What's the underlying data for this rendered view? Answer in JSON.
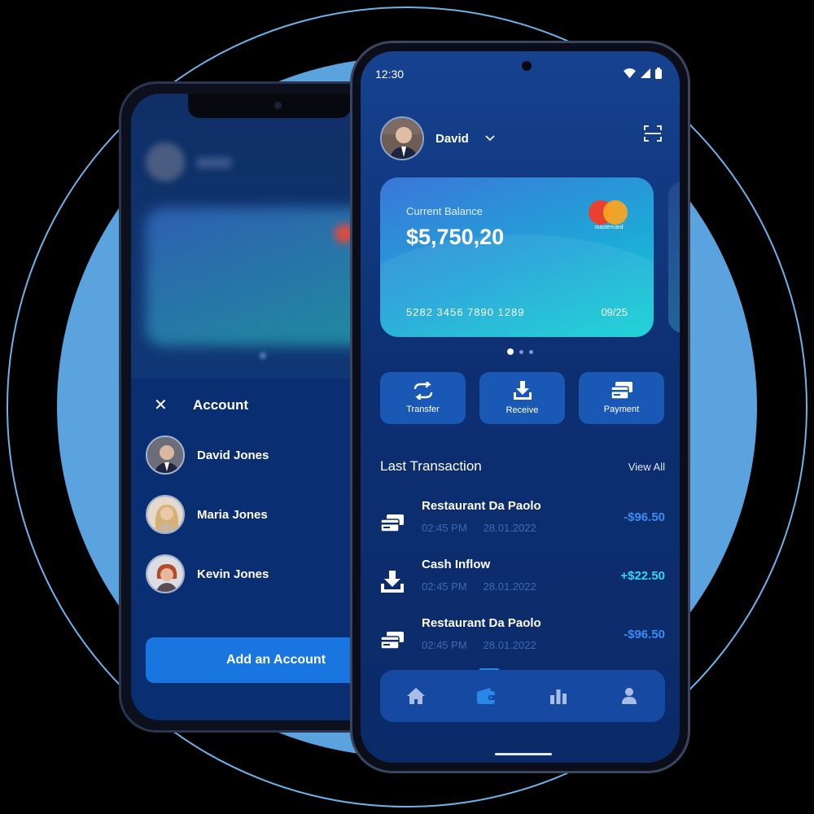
{
  "colors": {
    "background_circle": "#5aa3de",
    "screen_bg": "#0d2f72",
    "accent_blue": "#1976e0",
    "negative_amount": "#3d8cf0",
    "positive_amount": "#35d7f0",
    "card_gradient_start": "#3b76d9",
    "card_gradient_end": "#12d2d4"
  },
  "account_sheet": {
    "close_icon": "close-icon",
    "title": "Account",
    "accounts": [
      {
        "name": "David Jones"
      },
      {
        "name": "Maria Jones"
      },
      {
        "name": "Kevin Jones"
      }
    ],
    "add_button_label": "Add an Account"
  },
  "status_bar": {
    "time": "12:30",
    "icons": [
      "wifi-icon",
      "signal-icon",
      "battery-icon"
    ]
  },
  "profile": {
    "name": "David",
    "dropdown_icon": "chevron-down-icon",
    "scan_icon": "scan-icon"
  },
  "card": {
    "label": "Current Balance",
    "balance": "$5,750,20",
    "brand": "mastercard",
    "number": "5282 3456 7890 1289",
    "expiry": "09/25",
    "page_indicator": {
      "count": 3,
      "active_index": 0
    }
  },
  "actions": [
    {
      "label": "Transfer",
      "icon": "transfer-icon"
    },
    {
      "label": "Receive",
      "icon": "download-icon"
    },
    {
      "label": "Payment",
      "icon": "cards-icon"
    }
  ],
  "transactions_section": {
    "title": "Last Transaction",
    "view_all": "View All"
  },
  "transactions": [
    {
      "title": "Restaurant Da Paolo",
      "time": "02:45 PM",
      "date": "28.01.2022",
      "amount": "-$96.50",
      "icon": "cards-icon",
      "type": "debit"
    },
    {
      "title": "Cash Inflow",
      "time": "02:45 PM",
      "date": "28.01.2022",
      "amount": "+$22.50",
      "icon": "download-icon",
      "type": "credit"
    },
    {
      "title": "Restaurant Da Paolo",
      "time": "02:45 PM",
      "date": "28.01.2022",
      "amount": "-$96.50",
      "icon": "cards-icon",
      "type": "debit"
    }
  ],
  "bottom_nav": {
    "items": [
      "home-icon",
      "wallet-icon",
      "chart-icon",
      "user-icon"
    ],
    "active_index": 1
  }
}
